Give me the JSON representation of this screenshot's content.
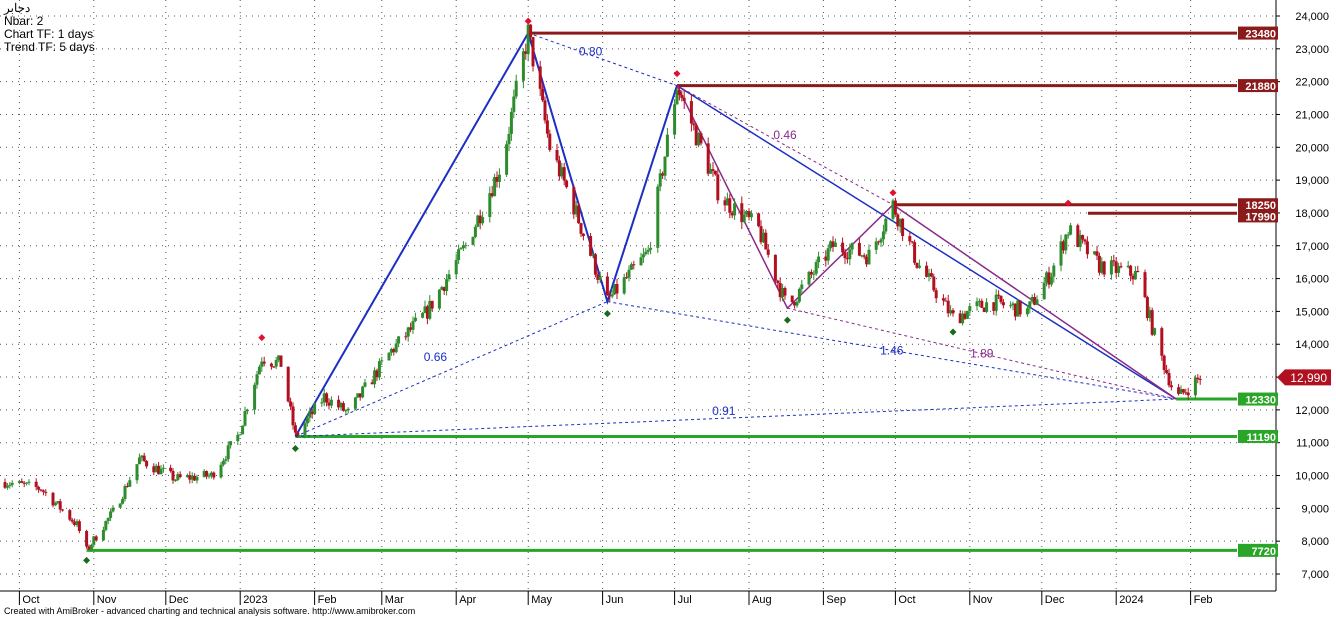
{
  "legend": {
    "symbol": "دجابر",
    "nbar": "Nbar: 2",
    "chart_tf": "Chart TF: 1 days",
    "trend_tf": "Trend TF: 5 days"
  },
  "footer": "Created with AmiBroker - advanced charting and technical analysis software. http://www.amibroker.com",
  "colors": {
    "up_candle": "#2e8b2e",
    "down_candle": "#b01020",
    "resistance": "#8b1a1a",
    "support": "#2aa52a",
    "blue_trend": "#1c2fc4",
    "purple_trend": "#8a2a8a",
    "last_price_box": "#b01020"
  },
  "chart_data": {
    "type": "candlestick",
    "x_tick_labels": [
      "Oct",
      "Nov",
      "Dec",
      "2023",
      "Feb",
      "Mar",
      "Apr",
      "May",
      "Jun",
      "Jul",
      "Aug",
      "Sep",
      "Oct",
      "Nov",
      "Dec",
      "2024",
      "Feb"
    ],
    "y_tick_labels": [
      "7,000",
      "8,000",
      "9,000",
      "10,000",
      "11,000",
      "12,000",
      "13,000",
      "14,000",
      "15,000",
      "16,000",
      "17,000",
      "18,000",
      "19,000",
      "20,000",
      "21,000",
      "22,000",
      "23,000",
      "24,000"
    ],
    "ylim": [
      6600,
      24300
    ],
    "last_price": 12990,
    "last_price_label": "12,990",
    "resistance_levels": [
      {
        "label": "23480",
        "value": 23480
      },
      {
        "label": "21880",
        "value": 21880
      },
      {
        "label": "18250",
        "value": 18250
      },
      {
        "label": "17990",
        "value": 17990
      }
    ],
    "support_levels": [
      {
        "label": "12330",
        "value": 12330
      },
      {
        "label": "11190",
        "value": 11190
      },
      {
        "label": "7720",
        "value": 7720
      }
    ],
    "swing_points": [
      {
        "date": "2023-01-24",
        "price": 11190
      },
      {
        "date": "2023-05-01",
        "price": 23480
      },
      {
        "date": "2023-06-03",
        "price": 15300
      },
      {
        "date": "2023-07-02",
        "price": 21880
      },
      {
        "date": "2023-08-17",
        "price": 15100
      },
      {
        "date": "2023-09-30",
        "price": 18250
      },
      {
        "date": "2024-01-26",
        "price": 12330
      }
    ],
    "retracement_labels": [
      "0.80",
      "0.46",
      "0.66",
      "1.46",
      "1.89",
      "0.91"
    ],
    "path_waypoints": [
      {
        "date": "2022-09-25",
        "price": 9800
      },
      {
        "date": "2022-10-10",
        "price": 9600
      },
      {
        "date": "2022-10-25",
        "price": 8500
      },
      {
        "date": "2022-10-29",
        "price": 7720
      },
      {
        "date": "2022-11-10",
        "price": 9000
      },
      {
        "date": "2022-11-20",
        "price": 10500
      },
      {
        "date": "2022-12-05",
        "price": 9900
      },
      {
        "date": "2022-12-20",
        "price": 10000
      },
      {
        "date": "2022-12-31",
        "price": 11200
      },
      {
        "date": "2023-01-10",
        "price": 13600
      },
      {
        "date": "2023-01-18",
        "price": 13400
      },
      {
        "date": "2023-01-24",
        "price": 11190
      },
      {
        "date": "2023-02-05",
        "price": 12400
      },
      {
        "date": "2023-02-15",
        "price": 11900
      },
      {
        "date": "2023-03-05",
        "price": 13800
      },
      {
        "date": "2023-03-20",
        "price": 15000
      },
      {
        "date": "2023-04-05",
        "price": 17000
      },
      {
        "date": "2023-04-20",
        "price": 19500
      },
      {
        "date": "2023-05-01",
        "price": 23480
      },
      {
        "date": "2023-05-10",
        "price": 20000
      },
      {
        "date": "2023-05-20",
        "price": 18200
      },
      {
        "date": "2023-06-03",
        "price": 15300
      },
      {
        "date": "2023-06-20",
        "price": 16800
      },
      {
        "date": "2023-07-02",
        "price": 21880
      },
      {
        "date": "2023-07-20",
        "price": 18500
      },
      {
        "date": "2023-08-05",
        "price": 17500
      },
      {
        "date": "2023-08-17",
        "price": 15100
      },
      {
        "date": "2023-09-05",
        "price": 17000
      },
      {
        "date": "2023-09-20",
        "price": 16700
      },
      {
        "date": "2023-09-30",
        "price": 18250
      },
      {
        "date": "2023-10-10",
        "price": 16500
      },
      {
        "date": "2023-10-25",
        "price": 14800
      },
      {
        "date": "2023-11-10",
        "price": 15300
      },
      {
        "date": "2023-11-25",
        "price": 15000
      },
      {
        "date": "2023-12-05",
        "price": 16200
      },
      {
        "date": "2023-12-12",
        "price": 17500
      },
      {
        "date": "2023-12-25",
        "price": 16400
      },
      {
        "date": "2024-01-10",
        "price": 16100
      },
      {
        "date": "2024-01-18",
        "price": 14000
      },
      {
        "date": "2024-01-26",
        "price": 12330
      },
      {
        "date": "2024-02-05",
        "price": 12990
      }
    ]
  }
}
